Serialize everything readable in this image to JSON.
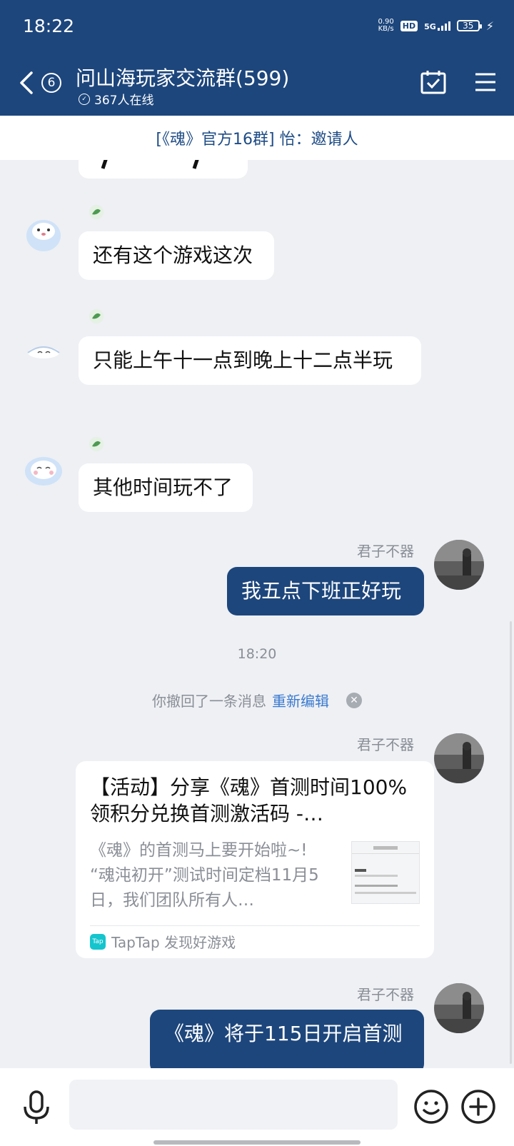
{
  "status_bar": {
    "time": "18:22",
    "net_speed_value": "0.90",
    "net_speed_unit": "KB/s",
    "hd": "HD",
    "network": "5G",
    "battery": "35"
  },
  "header": {
    "unread_count": "6",
    "title": "问山海玩家交流群(599)",
    "online": "367人在线"
  },
  "notice": {
    "text": "[《魂》官方16群] 怡：邀请人"
  },
  "messages": {
    "m1": "还有这个游戏这次",
    "m2": "只能上午十一点到晚上十二点半玩",
    "m3": "其他时间玩不了",
    "me_name": "君子不器",
    "me1": "我五点下班正好玩",
    "time_divider": "18:20",
    "recall_text": "你撤回了一条消息",
    "recall_link": "重新编辑",
    "card": {
      "title": "【活动】分享《魂》首测时间100%领积分兑换首测激活码 -…",
      "description": "《魂》的首测马上要开始啦~! “魂沌初开”测试时间定档11月5日，我们团队所有人…",
      "source_logo": "Tap",
      "source": "TapTap 发现好游戏"
    },
    "me3": "《魂》将于115日开启首测"
  },
  "colors": {
    "header_bg": "#1d467c",
    "chat_bg": "#eef0f4",
    "my_bubble": "#1d467c",
    "link": "#3b7ad0"
  }
}
